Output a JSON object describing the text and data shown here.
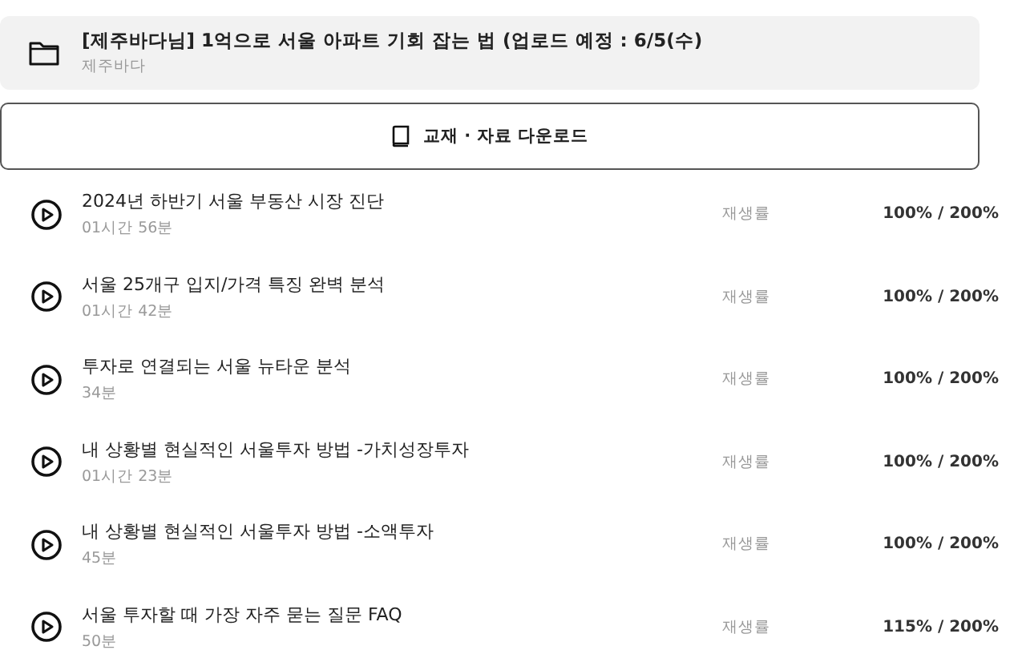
{
  "course": {
    "title": "[제주바다님] 1억으로 서울 아파트 기회 잡는 법 (업로드 예정 : 6/5(수)",
    "author": "제주바다"
  },
  "download_button": {
    "label": "교재 · 자료 다운로드"
  },
  "lessons": [
    {
      "title": "2024년 하반기 서울 부동산 시장 진단",
      "duration": "01시간 56분",
      "rate_label": "재생률",
      "rate": "100% / 200%"
    },
    {
      "title": "서울 25개구 입지/가격 특징 완벽 분석",
      "duration": "01시간 42분",
      "rate_label": "재생률",
      "rate": "100% / 200%"
    },
    {
      "title": "투자로 연결되는 서울 뉴타운 분석",
      "duration": "34분",
      "rate_label": "재생률",
      "rate": "100% / 200%"
    },
    {
      "title": "내 상황별 현실적인 서울투자 방법 -가치성장투자",
      "duration": "01시간 23분",
      "rate_label": "재생률",
      "rate": "100% / 200%"
    },
    {
      "title": "내 상황별 현실적인 서울투자 방법 -소액투자",
      "duration": "45분",
      "rate_label": "재생률",
      "rate": "100% / 200%"
    },
    {
      "title": "서울 투자할 때 가장 자주 묻는 질문 FAQ",
      "duration": "50분",
      "rate_label": "재생률",
      "rate": "115% / 200%"
    }
  ]
}
